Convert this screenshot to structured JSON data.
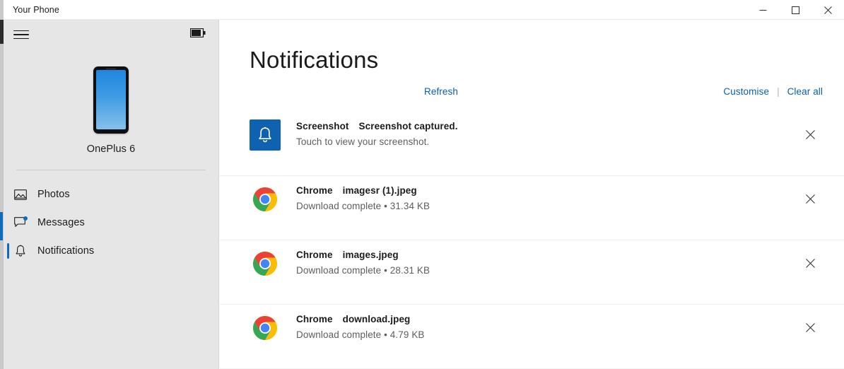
{
  "window": {
    "title": "Your Phone",
    "controls": [
      {
        "name": "minimize",
        "label": "—"
      },
      {
        "name": "maximize",
        "label": "□"
      },
      {
        "name": "close",
        "label": "✕"
      }
    ]
  },
  "sidebar": {
    "menu_icon": "hamburger-icon",
    "battery_icon": "battery-icon",
    "device_name": "OnePlus 6",
    "items": [
      {
        "label": "Photos",
        "icon": "photos-icon",
        "selected": false,
        "badge": false
      },
      {
        "label": "Messages",
        "icon": "messages-icon",
        "selected": false,
        "badge": true
      },
      {
        "label": "Notifications",
        "icon": "bell-icon",
        "selected": true,
        "badge": false
      }
    ]
  },
  "main": {
    "title": "Notifications",
    "refresh_label": "Refresh",
    "customise_label": "Customise",
    "separator": "|",
    "clear_all_label": "Clear all",
    "dismiss_icon": "close-icon",
    "notifications": [
      {
        "icon": "bell-icon",
        "icon_style": "blue-tile",
        "app": "Screenshot",
        "title": "Screenshot captured.",
        "body": "Touch to view your screenshot."
      },
      {
        "icon": "chrome-icon",
        "icon_style": "chrome",
        "app": "Chrome",
        "title": "imagesr (1).jpeg",
        "body": "Download complete • 31.34 KB"
      },
      {
        "icon": "chrome-icon",
        "icon_style": "chrome",
        "app": "Chrome",
        "title": "images.jpeg",
        "body": "Download complete • 28.31 KB"
      },
      {
        "icon": "chrome-icon",
        "icon_style": "chrome",
        "app": "Chrome",
        "title": "download.jpeg",
        "body": "Download complete • 4.79 KB"
      }
    ]
  },
  "colors": {
    "accent": "#0f6cbd",
    "link": "#0b5fa5",
    "sidebar_bg": "#e6e6e6",
    "screenshot_tile": "#0f62b0",
    "chrome_red": "#ea4335",
    "chrome_green": "#34a853",
    "chrome_yellow": "#fbbc05",
    "chrome_blue": "#4285f4"
  }
}
